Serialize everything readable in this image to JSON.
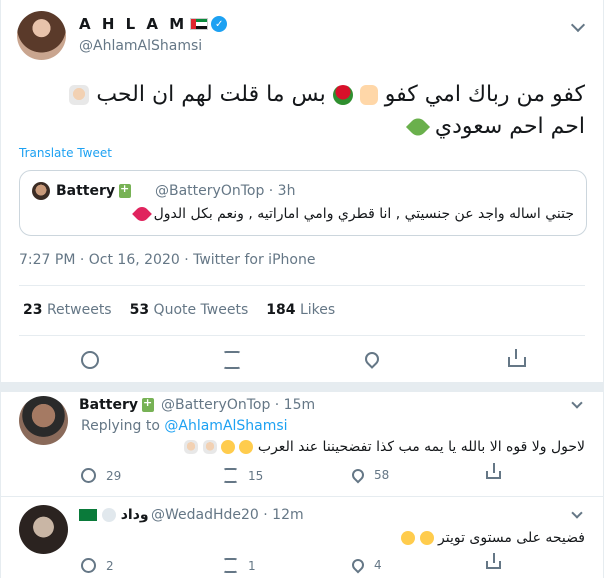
{
  "tweet": {
    "author_name": "A H L A M",
    "author_handle": "@AhlamAlShamsi",
    "text_line1": "كفو من رباك امي كفو",
    "text_line1b": "بس ما قلت لهم ان الحب",
    "text_line2": "احم احم سعودي",
    "translate_label": "Translate Tweet",
    "timestamp": "7:27 PM · Oct 16, 2020 · Twitter for iPhone"
  },
  "quote": {
    "name": "Battery",
    "handle": "@BatteryOnTop · 3h",
    "text": "جتني اساله واجد عن جنسيتي , انا قطري وامي اماراتيه , ونعم بكل الدول"
  },
  "stats": {
    "retweets_count": "23",
    "retweets_label": "Retweets",
    "quotes_count": "53",
    "quotes_label": "Quote Tweets",
    "likes_count": "184",
    "likes_label": "Likes"
  },
  "replies": [
    {
      "name": "Battery",
      "handle": "@BatteryOnTop · 15m",
      "replying_to_label": "Replying to",
      "replying_to_handle": "@AhlamAlShamsi",
      "text": "لاحول ولا قوه الا بالله يا يمه مب كذا تفضحيننا عند العرب",
      "reply_count": "29",
      "retweet_count": "15",
      "like_count": "58"
    },
    {
      "name": "وداد",
      "handle": "@WedadHde20 · 12m",
      "text": "فضيحه على مستوى تويتر",
      "reply_count": "2",
      "retweet_count": "1",
      "like_count": "4"
    }
  ],
  "icons": {
    "reply": "reply-icon",
    "retweet": "retweet-icon",
    "like": "heart-icon",
    "share": "share-icon",
    "verified": "verified-badge-icon",
    "more": "chevron-down-icon"
  },
  "colors": {
    "link": "#1da1f2",
    "muted": "#657786",
    "text": "#14171a",
    "border": "#e6ecf0"
  }
}
